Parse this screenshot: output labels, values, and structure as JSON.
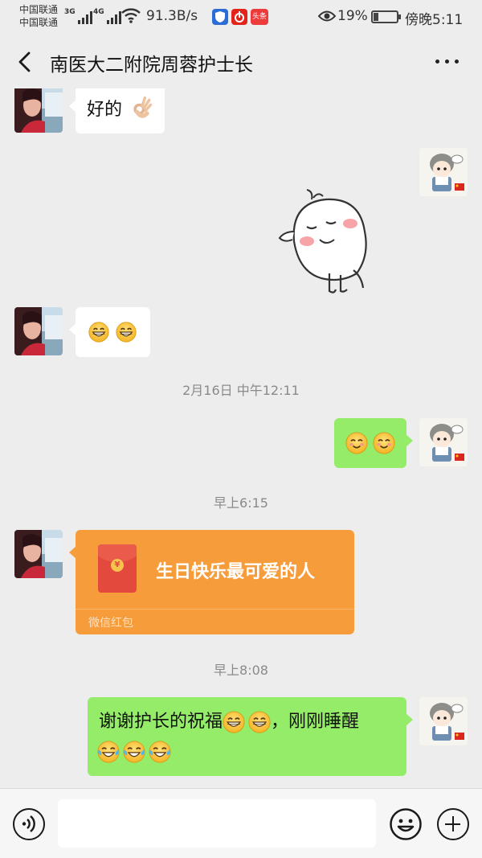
{
  "status_bar": {
    "carrier_1": "中国联通",
    "carrier_2": "中国联通",
    "sim1_gen": "3G",
    "sim2_gen": "4G",
    "net_speed": "91.3B/s",
    "battery_percent": "19%",
    "time": "傍晚5:11",
    "icons": [
      "signal-icon",
      "wifi-icon",
      "shield-app-icon",
      "netease-music-icon",
      "toutiao-icon",
      "eye-icon",
      "battery-icon"
    ],
    "toutiao_label": "头条"
  },
  "header": {
    "title": "南医大二附院周蓉护士长"
  },
  "messages": [
    {
      "sender": "other",
      "type": "text",
      "text": "好的",
      "emoji": [
        "ok-hand"
      ]
    },
    {
      "sender": "me",
      "type": "sticker",
      "sticker": "shy-cartoon-sticker"
    },
    {
      "sender": "other",
      "type": "emoji",
      "emoji": [
        "grin",
        "grin"
      ]
    },
    {
      "type": "timestamp",
      "text": "2月16日 中午12:11"
    },
    {
      "sender": "me",
      "type": "emoji",
      "emoji": [
        "blush",
        "blush"
      ]
    },
    {
      "type": "timestamp",
      "text": "早上6:15"
    },
    {
      "sender": "other",
      "type": "red_packet",
      "title": "生日快乐最可爱的人",
      "label": "微信红包",
      "coin": "¥"
    },
    {
      "type": "timestamp",
      "text": "早上8:08"
    },
    {
      "sender": "me",
      "type": "text",
      "text": "谢谢护长的祝福",
      "text_2": "，刚刚睡醒",
      "emoji": [
        "grin",
        "grin",
        "joy",
        "joy",
        "joy"
      ]
    }
  ],
  "colors": {
    "background": "#ededed",
    "my_bubble": "#95ec69",
    "other_bubble": "#ffffff",
    "red_packet": "#f79c3b",
    "timestamp_text": "#8a8a8a"
  },
  "input_bar": {
    "voice_icon": "voice-icon",
    "emoji_icon": "smiley-icon",
    "plus_icon": "plus-icon"
  }
}
